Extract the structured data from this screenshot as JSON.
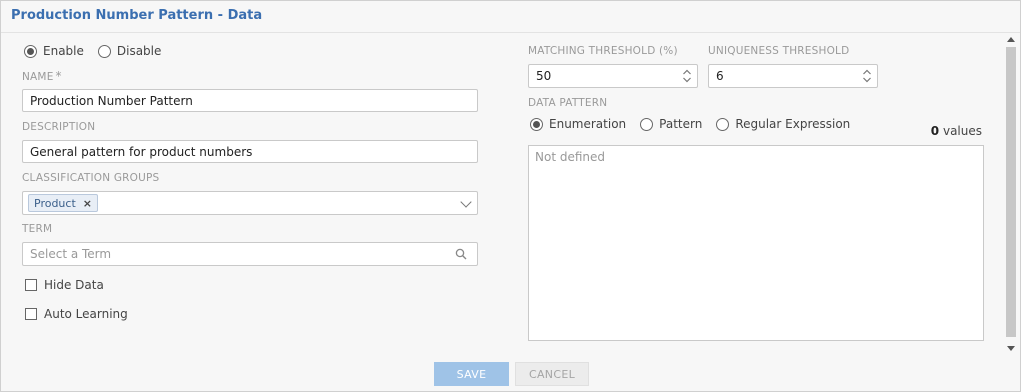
{
  "dialog": {
    "title": "Production Number Pattern - Data"
  },
  "status": {
    "options": [
      "Enable",
      "Disable"
    ],
    "selected": "Enable"
  },
  "name": {
    "label": "NAME",
    "required_mark": "*",
    "value": "Production Number Pattern"
  },
  "description": {
    "label": "DESCRIPTION",
    "value": "General pattern for product numbers"
  },
  "classification": {
    "label": "CLASSIFICATION GROUPS",
    "tags": [
      "Product"
    ],
    "tag_remove": "×"
  },
  "term": {
    "label": "TERM",
    "placeholder": "Select a Term"
  },
  "options": {
    "hide_data": "Hide Data",
    "auto_learning": "Auto Learning"
  },
  "matching": {
    "label": "MATCHING THRESHOLD (%)",
    "value": "50"
  },
  "uniqueness": {
    "label": "UNIQUENESS THRESHOLD",
    "value": "6"
  },
  "data_pattern": {
    "label": "DATA PATTERN",
    "options": [
      "Enumeration",
      "Pattern",
      "Regular Expression"
    ],
    "selected": "Enumeration",
    "values_count": "0",
    "values_suffix": "values",
    "empty_text": "Not defined"
  },
  "buttons": {
    "save": "SAVE",
    "cancel": "CANCEL"
  },
  "colors": {
    "title": "#3b6fb0",
    "save_bg": "#9fc3e7",
    "tag_bg": "#e8eef6"
  }
}
